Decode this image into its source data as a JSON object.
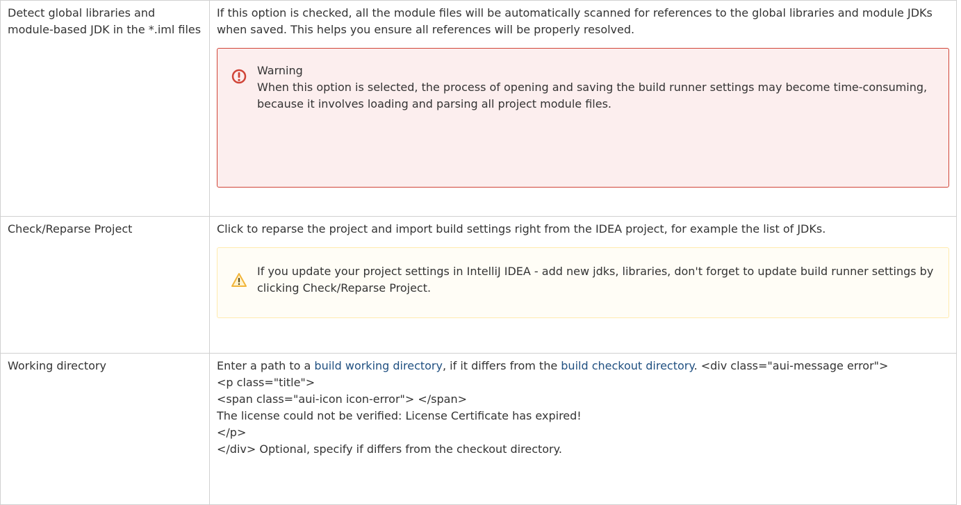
{
  "rows": [
    {
      "name": "Detect global libraries and module-based JDK in the *.iml files",
      "description": "If this option is checked, all the module files will be automatically scanned for references to the global libraries and module JDKs when saved. This helps you ensure all references will be properly resolved.",
      "message": {
        "type": "error",
        "icon": "error-icon",
        "title": "Warning",
        "body": "When this option is selected, the process of opening and saving the build runner settings may become time-consuming, because it involves loading and parsing all project module files."
      }
    },
    {
      "name": "Check/Reparse Project",
      "description": "Click to reparse the project and import build settings right from the IDEA project, for example the list of JDKs.",
      "message": {
        "type": "warning",
        "icon": "warning-icon",
        "body": "If you update your project settings in IntelliJ IDEA - add new jdks, libraries, don't forget to update build runner settings by clicking Check/Reparse Project."
      }
    },
    {
      "name": "Working directory",
      "description_pre": "Enter a path to a ",
      "link1": "build working directory",
      "description_mid": ", if it differs from the ",
      "link2": "build checkout directory",
      "description_post": ". <div class=\"aui-message error\">",
      "raw_lines": [
        "<p class=\"title\">",
        "<span class=\"aui-icon icon-error\"> </span>",
        "The license could not be verified: License Certificate has expired!",
        "</p>",
        "</div> Optional, specify if differs from the checkout directory."
      ]
    }
  ],
  "colors": {
    "link": "#205081",
    "error_border": "#d04437",
    "error_bg": "#fceeee",
    "warning_border": "#ffeaae",
    "warning_bg": "#fffdf6",
    "warning_icon": "#f2b53a",
    "error_icon": "#d04437"
  }
}
